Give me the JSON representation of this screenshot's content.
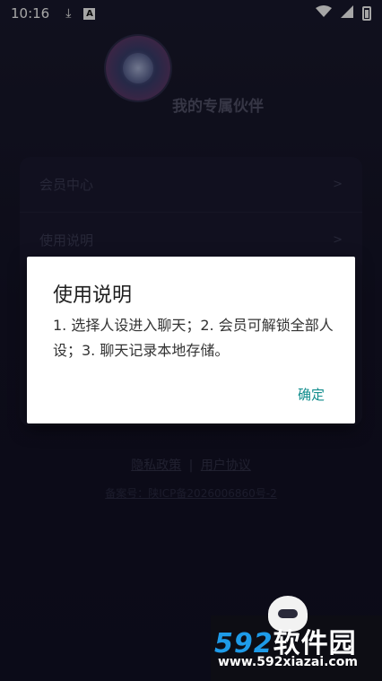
{
  "status_bar": {
    "time": "10:16",
    "download_icon": "download-icon",
    "sim_icon": "a-icon",
    "wifi_icon": "wifi-icon",
    "signal_icon": "signal-icon",
    "battery_icon": "battery-icon"
  },
  "header": {
    "title": "我的专属伙伴"
  },
  "menu": {
    "items": [
      {
        "label": "会员中心",
        "chevron": ">"
      },
      {
        "label": "使用说明",
        "chevron": ">"
      }
    ]
  },
  "footer": {
    "privacy_link": "隐私政策",
    "separator": "|",
    "agreement_link": "用户协议",
    "icp": "备案号：陕ICP备2026006860号-2"
  },
  "dialog": {
    "title": "使用说明",
    "body": "1. 选择人设进入聊天；2. 会员可解锁全部人设；3. 聊天记录本地存储。",
    "ok_label": "确定"
  },
  "watermark": {
    "logo_number": "592",
    "logo_text": "软件园",
    "url": "www.592xiazai.com"
  },
  "colors": {
    "background": "#15142a",
    "dialog_accent": "#118d8d",
    "watermark_blue": "#1e9be8"
  }
}
